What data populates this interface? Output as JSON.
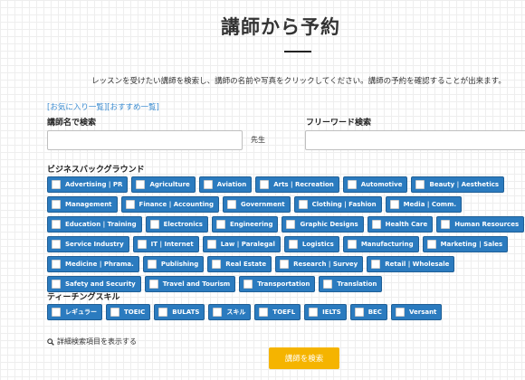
{
  "page": {
    "title": "講師から予約",
    "intro": "レッスンを受けたい講師を検索し、講師の名前や写真をクリックしてください。講師の予約を確認することが出来ます。"
  },
  "links": {
    "favorites": "[お気に入り一覧]",
    "recommended": "[おすすめ一覧]"
  },
  "search": {
    "name_label": "講師名で検索",
    "name_value": "",
    "name_suffix": "先生",
    "freeword_label": "フリーワード検索",
    "freeword_value": ""
  },
  "business": {
    "label": "ビジネスバックグラウンド",
    "tags": [
      "Advertising | PR",
      "Agriculture",
      "Aviation",
      "Arts | Recreation",
      "Automotive",
      "Beauty | Aesthetics",
      "Management",
      "Finance | Accounting",
      "Government",
      "Clothing | Fashion",
      "Media | Comm.",
      "Education | Training",
      "Electronics",
      "Engineering",
      "Graphic Designs",
      "Health Care",
      "Human Resources",
      "Service Industry",
      "IT | Internet",
      "Law | Paralegal",
      "Logistics",
      "Manufacturing",
      "Marketing | Sales",
      "Medicine | Phrama.",
      "Publishing",
      "Real Estate",
      "Research | Survey",
      "Retail | Wholesale",
      "Safety and Security",
      "Travel and Tourism",
      "Transportation",
      "Translation"
    ]
  },
  "teaching": {
    "label": "ティーチングスキル",
    "tags": [
      "レギュラー",
      "TOEIC",
      "BULATS",
      "スキル",
      "TOEFL",
      "IELTS",
      "BEC",
      "Versant"
    ]
  },
  "advanced": {
    "label": "詳細検索項目を表示する",
    "icon": "magnifier-icon"
  },
  "submit": {
    "label": "講師を検索"
  },
  "colors": {
    "tag_bg": "#2b7bbf",
    "button_bg": "#f5b400",
    "link": "#3a8bd0"
  }
}
